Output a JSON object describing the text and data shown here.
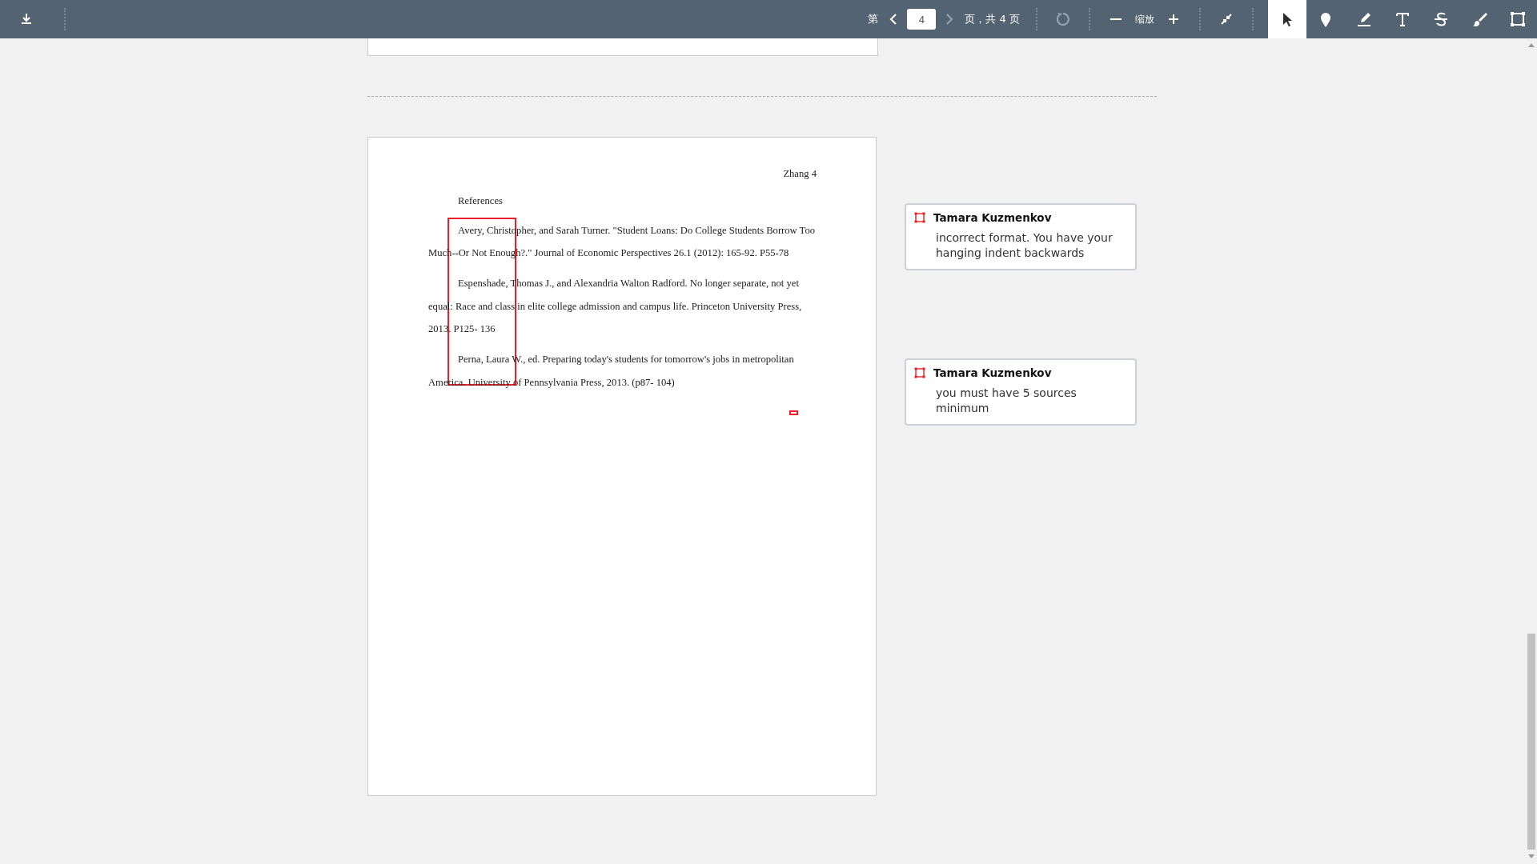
{
  "toolbar": {
    "page_prefix": "第",
    "page_input": "4",
    "page_suffix": "页，共 4 页",
    "zoom_label": "缩放",
    "tools": [
      {
        "kind": "select",
        "selected": true
      },
      {
        "kind": "pin",
        "selected": false
      },
      {
        "kind": "highlight",
        "selected": false
      },
      {
        "kind": "text",
        "selected": false
      },
      {
        "kind": "strike",
        "selected": false
      },
      {
        "kind": "brush",
        "selected": false
      },
      {
        "kind": "area",
        "selected": false
      }
    ]
  },
  "page": {
    "header": "Zhang 4",
    "heading": "References",
    "references": [
      {
        "lines": [
          "Avery, Christopher, and Sarah Turner. \"Student Loans: Do College Students Borrow Too",
          "Much--Or Not Enough?.\" Journal of Economic Perspectives 26.1 (2012): 165-92. P55-78"
        ]
      },
      {
        "lines": [
          "Espenshade, Thomas J., and Alexandria Walton Radford. No longer separate, not yet",
          "equal: Race and class in elite college admission and campus life. Princeton University Press,",
          "2013. P125- 136"
        ]
      },
      {
        "lines": [
          "Perna, Laura W., ed. Preparing today's students for tomorrow's jobs in metropolitan",
          "America. University of Pennsylvania Press, 2013. (p87- 104)"
        ]
      }
    ]
  },
  "comments": [
    {
      "author": "Tamara Kuzmenkov",
      "text": "incorrect format. You have your hanging indent backwards"
    },
    {
      "author": "Tamara Kuzmenkov",
      "text": "you must have 5 sources minimum"
    }
  ]
}
